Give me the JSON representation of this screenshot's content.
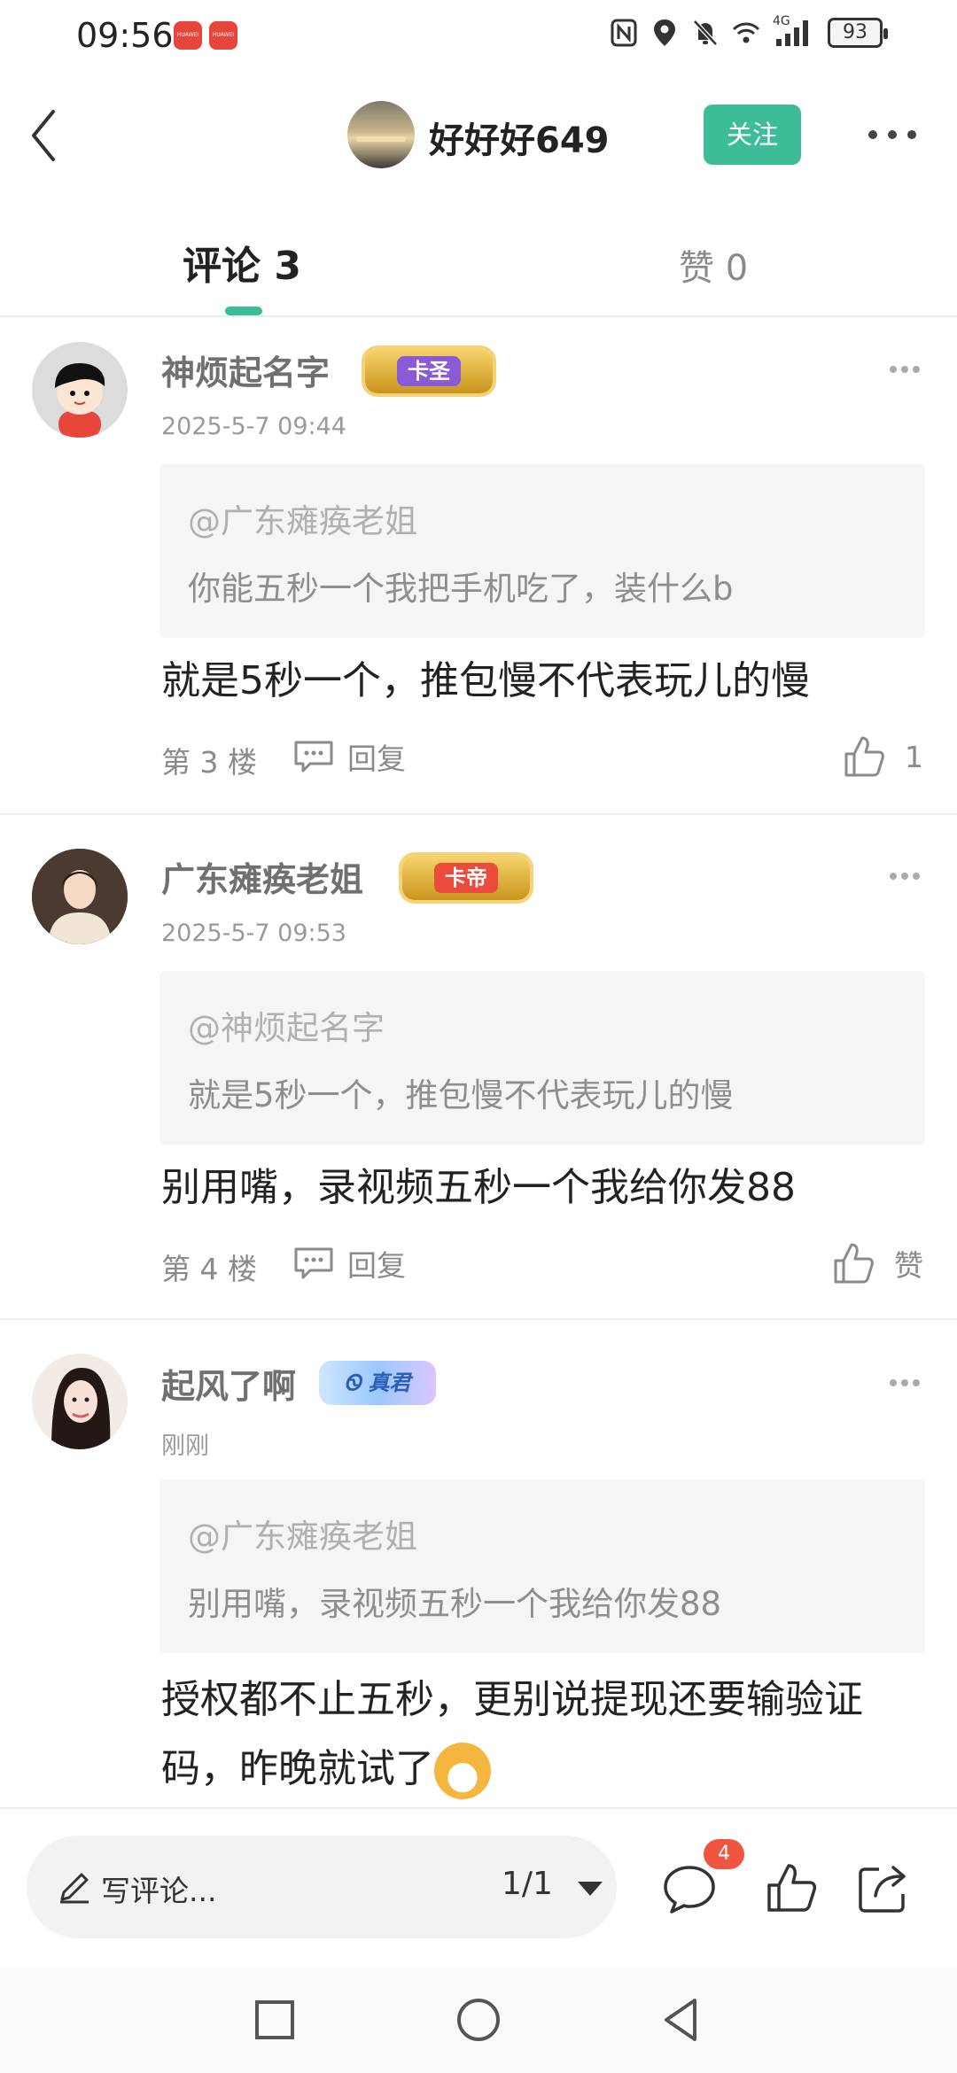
{
  "status_bar": {
    "time": "09:56",
    "network": "4G",
    "battery": "93",
    "icons": [
      "huawei-app-icon",
      "huawei-app-icon",
      "nfc-icon",
      "location-icon",
      "mute-icon",
      "wifi-icon",
      "signal-icon",
      "battery-icon"
    ]
  },
  "header": {
    "title": "好好好649",
    "follow_label": "关注"
  },
  "tabs": {
    "comments": "评论 3",
    "likes": "赞 0"
  },
  "comments": [
    {
      "name": "神烦起名字",
      "badge": "卡圣",
      "time": "2025-5-7 09:44",
      "quote_at": "@广东瘫痪老姐",
      "quote_text": "你能五秒一个我把手机吃了，装什么b",
      "body": "就是5秒一个，推包慢不代表玩儿的慢",
      "floor": "第 3 楼",
      "reply": "回复",
      "likes": "1"
    },
    {
      "name": "广东瘫痪老姐",
      "badge": "卡帝",
      "time": "2025-5-7 09:53",
      "quote_at": "@神烦起名字",
      "quote_text": "就是5秒一个，推包慢不代表玩儿的慢",
      "body": "别用嘴，录视频五秒一个我给你发88",
      "floor": "第 4 楼",
      "reply": "回复",
      "likes": "赞"
    },
    {
      "name": "起风了啊",
      "badge": "Ꮻ 真君",
      "time": "刚刚",
      "quote_at": "@广东瘫痪老姐",
      "quote_text": "别用嘴，录视频五秒一个我给你发88",
      "body": "授权都不止五秒，更别说提现还要输验证码，昨晚就试了"
    }
  ],
  "bottom_bar": {
    "write_placeholder": "写评论...",
    "pager": "1/1",
    "comment_count": "4"
  },
  "colors": {
    "accent": "#3cbd98",
    "badge_red": "#f0563f"
  }
}
